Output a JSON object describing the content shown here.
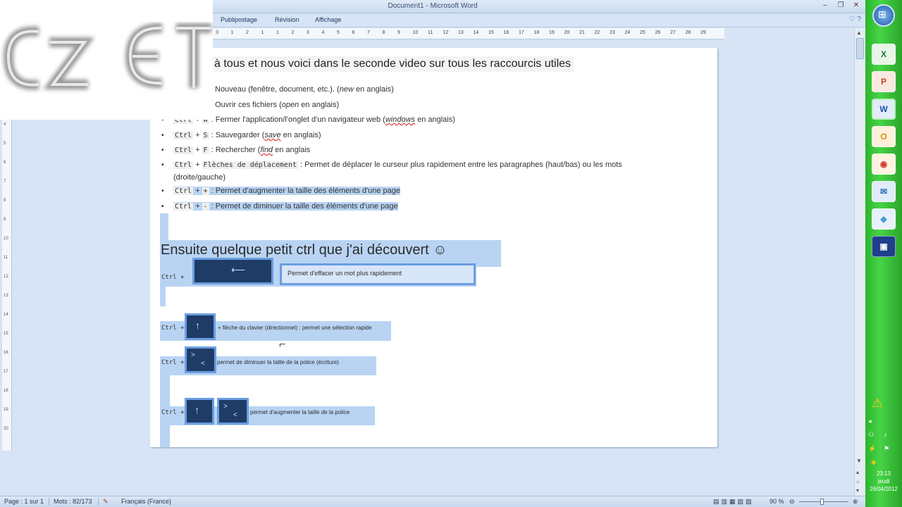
{
  "window": {
    "title": "Document1 - Microsoft Word",
    "minimize": "‒",
    "maximize": "❐",
    "close": "✕"
  },
  "ribbon_tabs": [
    "Publipostage",
    "Révision",
    "Affichage"
  ],
  "help": "♡ ?",
  "ruler_ticks": [
    "3",
    "1",
    "2",
    "1",
    "1",
    "2",
    "3",
    "4",
    "5",
    "6",
    "7",
    "8",
    "9",
    "10",
    "11",
    "12",
    "13",
    "14",
    "15",
    "16",
    "17",
    "18",
    "19",
    "20",
    "21",
    "22",
    "23",
    "24",
    "25",
    "26",
    "27",
    "28",
    "29"
  ],
  "vruler_ticks": [
    "4",
    "5",
    "6",
    "7",
    "8",
    "9",
    "10",
    "11",
    "12",
    "13",
    "14",
    "15",
    "16",
    "17",
    "18",
    "19",
    "20"
  ],
  "document": {
    "heading1": "à tous et nous voici dans le seconde video sur tous les raccourcis utiles",
    "line_nouveau_pre": "Nouveau (fenêtre, document, etc.). (",
    "line_nouveau_em": "new",
    "line_nouveau_post": " en anglais)",
    "line_ouvrir_pre": "Ouvrir ces fichiers (",
    "line_ouvrir_em": "open",
    "line_ouvrir_post": " en anglais)",
    "bullets": [
      {
        "k1": "Ctrl",
        "plus": "+",
        "k2": "W",
        "text_pre": " : Fermer l'application/l'onglet  d'un navigateur web (",
        "em": "windows",
        "text_post": " en anglais)"
      },
      {
        "k1": "Ctrl",
        "plus": "+",
        "k2": "S",
        "text_pre": " : Sauvegarder (",
        "em": "save",
        "text_post": " en anglais)"
      },
      {
        "k1": "Ctrl",
        "plus": "+",
        "k2": "F",
        "text_pre": " : Rechercher (",
        "em": "find",
        "text_post": " en anglais"
      },
      {
        "k1": "Ctrl",
        "plus": "+",
        "k2": "Flèches de déplacement",
        "text_pre": " : Permet de déplacer le curseur plus rapidement entre les paragraphes (haut/bas) ou les mots",
        "em": "",
        "text_post": ""
      },
      {
        "k1": "Ctrl",
        "plus": "+",
        "k2": "+",
        "text_pre": " : Permet d'augmenter la taille des éléments d'une page",
        "em": "",
        "text_post": ""
      },
      {
        "k1": "Ctrl",
        "plus": "+",
        "k2": "-",
        "text_pre": " : Permet de diminuer la taille des éléments d'une page",
        "em": "",
        "text_post": ""
      }
    ],
    "bullet4_cont": "(droite/gauche)",
    "heading2": "Ensuite quelque petit ctrl que j'ai découvert ☺",
    "ctrl_plus": "Ctrl +",
    "row1_text": "Permet d'effacer un mot plus rapidement",
    "row2_text": "+ flèche du clavier (directionnel) : permet une sélection rapide",
    "row3_text": " permet de diminuer la taille de la police (écriture)",
    "row4_text": "permet d'augmenter la taille de la police"
  },
  "status": {
    "page": "Page : 1 sur 1",
    "words": "Mots : 82/173",
    "language": "Français (France)",
    "zoom": "90 %"
  },
  "taskbar": {
    "apps": [
      {
        "name": "excel-icon",
        "glyph": "X",
        "color": "#1f7a2e",
        "bg": "#e8f5e8"
      },
      {
        "name": "powerpoint-icon",
        "glyph": "P",
        "color": "#c4491c",
        "bg": "#fbe9e1"
      },
      {
        "name": "word-icon",
        "glyph": "W",
        "color": "#1e4ea1",
        "bg": "#e2ebfa"
      },
      {
        "name": "outlook-icon",
        "glyph": "O",
        "color": "#d98b12",
        "bg": "#fdf1dc"
      },
      {
        "name": "chrome-icon",
        "glyph": "◉",
        "color": "#d33a2c",
        "bg": "#fdf3e0"
      },
      {
        "name": "thunderbird-icon",
        "glyph": "✉",
        "color": "#2b6fb8",
        "bg": "#e0ecfa"
      },
      {
        "name": "app-icon",
        "glyph": "◆",
        "color": "#4a9ad8",
        "bg": "#e6f2fb"
      },
      {
        "name": "remote-desktop-icon",
        "glyph": "▣",
        "color": "#ffffff",
        "bg": "#1f3f8c"
      }
    ],
    "time": "23:13",
    "day": "jeudi",
    "date": "26/04/2012"
  }
}
